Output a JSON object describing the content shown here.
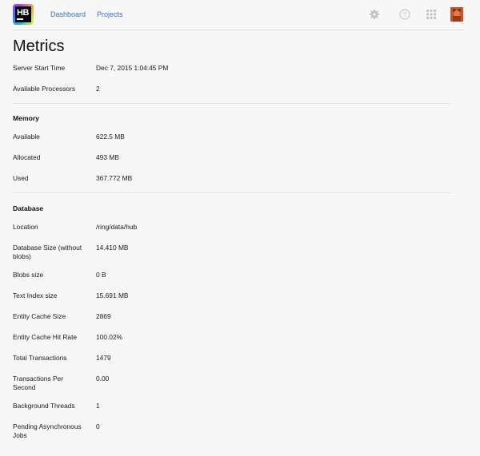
{
  "header": {
    "logo_text": "HB",
    "nav": [
      {
        "label": "Dashboard"
      },
      {
        "label": "Projects"
      }
    ],
    "icons": [
      "settings-icon",
      "help-icon",
      "apps-grid-icon",
      "user-avatar"
    ]
  },
  "page_title": "Metrics",
  "summary": [
    {
      "label": "Server Start Time",
      "value": "Dec 7, 2015 1:04:45 PM"
    },
    {
      "label": "Available Processors",
      "value": "2"
    }
  ],
  "memory": {
    "heading": "Memory",
    "rows": [
      {
        "label": "Available",
        "value": "622.5 MB"
      },
      {
        "label": "Allocated",
        "value": "493 MB"
      },
      {
        "label": "Used",
        "value": "367.772 MB"
      }
    ]
  },
  "database": {
    "heading": "Database",
    "rows": [
      {
        "label": "Location",
        "value": "/ring/data/hub"
      },
      {
        "label": "Database Size (without blobs)",
        "value": "14.410 MB"
      },
      {
        "label": "Blobs size",
        "value": "0 B"
      },
      {
        "label": "Text Index size",
        "value": "15.691 MB"
      },
      {
        "label": "Entity Cache Size",
        "value": "2869"
      },
      {
        "label": "Entity Cache Hit Rate",
        "value": "100.02%"
      },
      {
        "label": "Total Transactions",
        "value": "1479"
      },
      {
        "label": "Transactions Per Second",
        "value": "0.00"
      },
      {
        "label": "Background Threads",
        "value": "1"
      },
      {
        "label": "Pending Asynchronous Jobs",
        "value": "0"
      }
    ]
  },
  "colors": {
    "link": "#3a73c4",
    "background": "#f7f7f7",
    "avatar": "#c8552a"
  }
}
